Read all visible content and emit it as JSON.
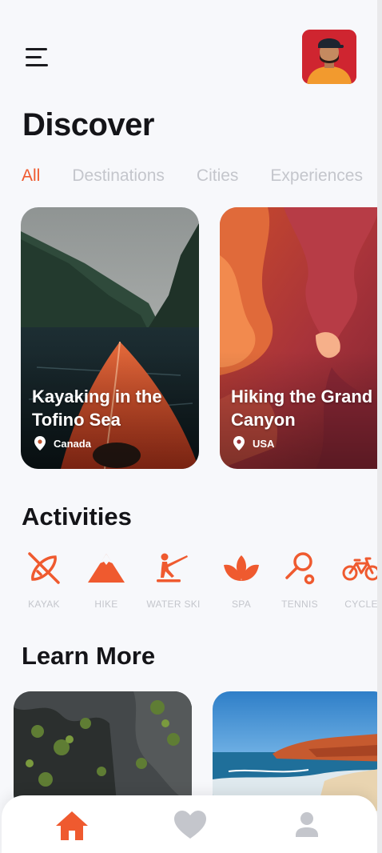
{
  "header": {
    "title": "Discover"
  },
  "tabs": [
    {
      "label": "All",
      "active": true
    },
    {
      "label": "Destinations",
      "active": false
    },
    {
      "label": "Cities",
      "active": false
    },
    {
      "label": "Experiences",
      "active": false
    }
  ],
  "featured": [
    {
      "title": "Kayaking in the Tofino Sea",
      "location": "Canada"
    },
    {
      "title": "Hiking the Grand Canyon",
      "location": "USA"
    }
  ],
  "activities_section": {
    "title": "Activities"
  },
  "activities": [
    {
      "label": "KAYAK",
      "icon": "kayak-icon"
    },
    {
      "label": "HIKE",
      "icon": "mountain-icon"
    },
    {
      "label": "WATER SKI",
      "icon": "water-ski-icon"
    },
    {
      "label": "SPA",
      "icon": "lotus-icon"
    },
    {
      "label": "TENNIS",
      "icon": "tennis-racket-icon"
    },
    {
      "label": "CYCLE",
      "icon": "bicycle-icon"
    }
  ],
  "learn_more": {
    "title": "Learn More"
  },
  "nav": [
    {
      "icon": "home-icon",
      "active": true
    },
    {
      "icon": "heart-icon",
      "active": false
    },
    {
      "icon": "profile-icon",
      "active": false
    }
  ],
  "colors": {
    "accent": "#ef5a2f",
    "inactive": "#c4c6cc",
    "text": "#141418",
    "background": "#f7f8fb"
  }
}
